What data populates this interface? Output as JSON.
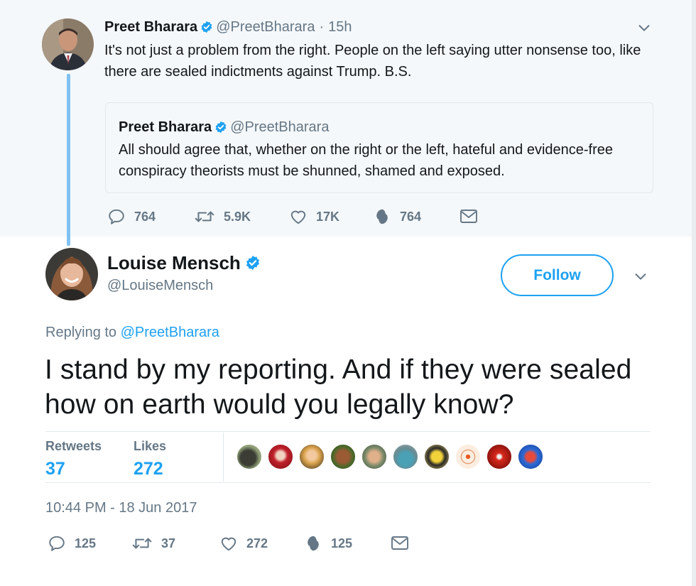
{
  "parent_tweet": {
    "author_name": "Preet Bharara",
    "author_handle": "@PreetBharara",
    "time": "15h",
    "separator": "·",
    "text": "It's not just a problem from the right. People on the left saying utter nonsense too, like there are sealed indictments against Trump. B.S.",
    "quoted": {
      "author_name": "Preet Bharara",
      "author_handle": "@PreetBharara",
      "text": "All should agree that, whether on the right or the left, hateful and evidence-free conspiracy theorists must be shunned, shamed and exposed."
    },
    "actions": {
      "replies": "764",
      "retweets": "5.9K",
      "likes": "17K",
      "moments": "764"
    }
  },
  "main_tweet": {
    "author_name": "Louise Mensch",
    "author_handle": "@LouiseMensch",
    "follow_label": "Follow",
    "replying_prefix": "Replying to",
    "replying_handle": "@PreetBharara",
    "text": "I stand by my reporting. And if they were sealed how on earth would you legally know?",
    "stats": {
      "retweets_label": "Retweets",
      "retweets_value": "37",
      "likes_label": "Likes",
      "likes_value": "272"
    },
    "likers": [
      "dark-green",
      "red-rose",
      "blonde",
      "brown-dog",
      "glasses",
      "teal-car",
      "yellow-cartoon",
      "target",
      "red-muppet",
      "blue-face"
    ],
    "timestamp": "10:44 PM - 18 Jun 2017",
    "actions": {
      "replies": "125",
      "retweets": "37",
      "likes": "272",
      "moments": "125"
    }
  },
  "colors": {
    "accent": "#1da1f2",
    "muted": "#657786",
    "text": "#14171a",
    "parent_bg": "#f5f8fa",
    "thread_line": "#7fc2f2"
  },
  "icons": [
    "reply-icon",
    "retweet-icon",
    "like-icon",
    "moments-icon",
    "message-icon",
    "verified-icon",
    "chevron-down-icon"
  ]
}
